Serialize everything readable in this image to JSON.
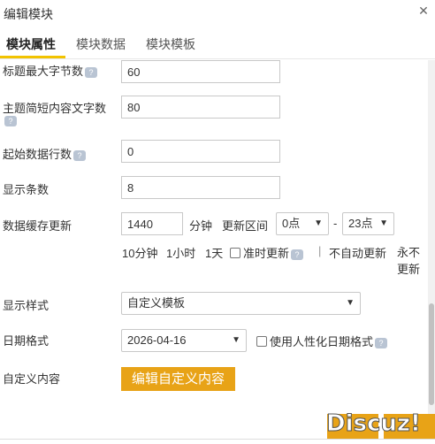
{
  "dialog": {
    "title": "编辑模块",
    "close_glyph": "✕"
  },
  "tabs": [
    {
      "label": "模块属性"
    },
    {
      "label": "模块数据"
    },
    {
      "label": "模块模板"
    }
  ],
  "form": {
    "title_max_label": "标题最大字节数",
    "title_max_value": "60",
    "summary_len_label": "主题简短内容文字数",
    "summary_len_value": "80",
    "start_row_label": "起始数据行数",
    "start_row_value": "0",
    "display_count_label": "显示条数",
    "display_count_value": "8",
    "cache_label": "数据缓存更新",
    "cache_value": "1440",
    "cache_unit": "分钟",
    "interval_label": "更新区间",
    "interval_start": "0点",
    "interval_dash": "-",
    "interval_end": "23点",
    "quick_10min": "10分钟",
    "quick_1h": "1小时",
    "quick_1d": "1天",
    "quick_ontime": "准时更新",
    "quick_sep": "|",
    "quick_noauto": "不自动更新",
    "quick_never": "永不更新",
    "style_label": "显示样式",
    "style_value": "自定义模板",
    "date_label": "日期格式",
    "date_value": "2026-04-16",
    "humanize_label": "使用人性化日期格式",
    "custom_label": "自定义内容",
    "custom_button": "编辑自定义内容",
    "help_glyph": "?"
  },
  "footer": {
    "watermark": "Discuz!"
  },
  "colors": {
    "accent": "#e8a317",
    "tab_underline": "#f2c300",
    "help_icon": "#b9c4d3"
  }
}
